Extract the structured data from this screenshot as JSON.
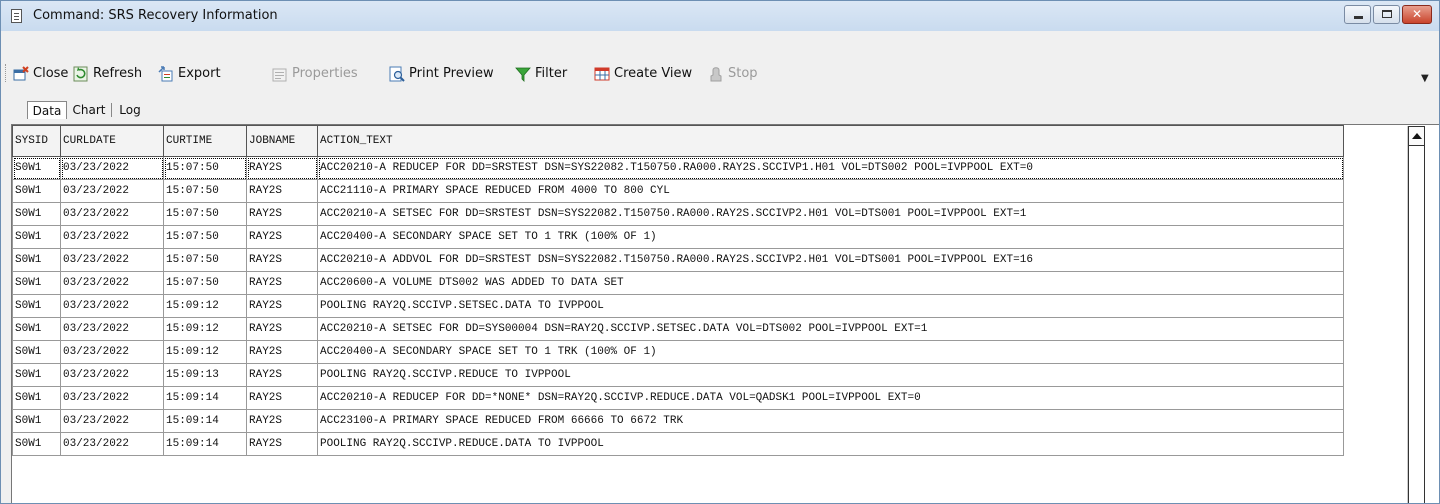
{
  "window": {
    "title": "Command: SRS Recovery Information"
  },
  "toolbar": {
    "close": "Close",
    "refresh": "Refresh",
    "export": "Export",
    "properties": "Properties",
    "print_preview": "Print Preview",
    "filter": "Filter",
    "create_view": "Create View",
    "stop": "Stop"
  },
  "tabs": [
    {
      "label": "Data"
    },
    {
      "label": "Chart"
    },
    {
      "label": "Log"
    }
  ],
  "grid": {
    "columns": [
      "SYSID",
      "CURLDATE",
      "CURTIME",
      "JOBNAME",
      "ACTION_TEXT"
    ],
    "rows": [
      [
        "S0W1",
        "03/23/2022",
        "15:07:50",
        "RAY2S",
        "ACC20210-A REDUCEP FOR DD=SRSTEST DSN=SYS22082.T150750.RA000.RAY2S.SCCIVP1.H01 VOL=DTS002 POOL=IVPPOOL EXT=0"
      ],
      [
        "S0W1",
        "03/23/2022",
        "15:07:50",
        "RAY2S",
        "ACC21110-A PRIMARY SPACE REDUCED FROM 4000 TO 800 CYL"
      ],
      [
        "S0W1",
        "03/23/2022",
        "15:07:50",
        "RAY2S",
        "ACC20210-A SETSEC FOR DD=SRSTEST DSN=SYS22082.T150750.RA000.RAY2S.SCCIVP2.H01 VOL=DTS001 POOL=IVPPOOL EXT=1"
      ],
      [
        "S0W1",
        "03/23/2022",
        "15:07:50",
        "RAY2S",
        "ACC20400-A SECONDARY SPACE SET TO 1 TRK (100% OF 1)"
      ],
      [
        "S0W1",
        "03/23/2022",
        "15:07:50",
        "RAY2S",
        "ACC20210-A ADDVOL FOR DD=SRSTEST DSN=SYS22082.T150750.RA000.RAY2S.SCCIVP2.H01 VOL=DTS001 POOL=IVPPOOL EXT=16"
      ],
      [
        "S0W1",
        "03/23/2022",
        "15:07:50",
        "RAY2S",
        "ACC20600-A VOLUME DTS002 WAS ADDED TO DATA SET"
      ],
      [
        "S0W1",
        "03/23/2022",
        "15:09:12",
        "RAY2S",
        "POOLING RAY2Q.SCCIVP.SETSEC.DATA TO IVPPOOL"
      ],
      [
        "S0W1",
        "03/23/2022",
        "15:09:12",
        "RAY2S",
        "ACC20210-A SETSEC FOR DD=SYS00004 DSN=RAY2Q.SCCIVP.SETSEC.DATA VOL=DTS002 POOL=IVPPOOL EXT=1"
      ],
      [
        "S0W1",
        "03/23/2022",
        "15:09:12",
        "RAY2S",
        "ACC20400-A SECONDARY SPACE SET TO 1 TRK (100% OF 1)"
      ],
      [
        "S0W1",
        "03/23/2022",
        "15:09:13",
        "RAY2S",
        "POOLING RAY2Q.SCCIVP.REDUCE TO IVPPOOL"
      ],
      [
        "S0W1",
        "03/23/2022",
        "15:09:14",
        "RAY2S",
        "ACC20210-A REDUCEP FOR DD=*NONE* DSN=RAY2Q.SCCIVP.REDUCE.DATA VOL=QADSK1 POOL=IVPPOOL EXT=0"
      ],
      [
        "S0W1",
        "03/23/2022",
        "15:09:14",
        "RAY2S",
        "ACC23100-A PRIMARY SPACE REDUCED FROM 66666 TO 6672 TRK"
      ],
      [
        "S0W1",
        "03/23/2022",
        "15:09:14",
        "RAY2S",
        "POOLING RAY2Q.SCCIVP.REDUCE.DATA TO IVPPOOL"
      ]
    ]
  }
}
